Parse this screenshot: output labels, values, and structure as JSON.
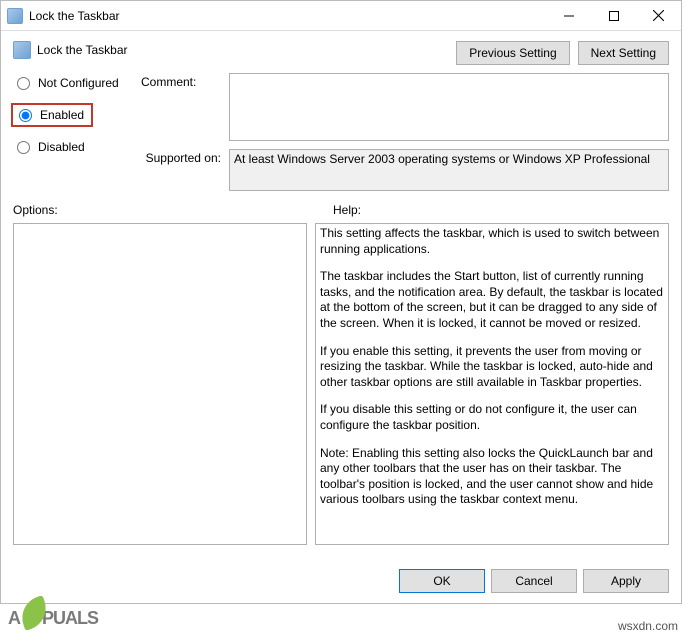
{
  "titlebar": {
    "title": "Lock the Taskbar"
  },
  "header": {
    "title": "Lock the Taskbar",
    "prev_label": "Previous Setting",
    "next_label": "Next Setting"
  },
  "radios": {
    "not_configured": "Not Configured",
    "enabled": "Enabled",
    "disabled": "Disabled",
    "selected": "Enabled"
  },
  "labels": {
    "comment": "Comment:",
    "supported": "Supported on:",
    "options": "Options:",
    "help": "Help:"
  },
  "comment_value": "",
  "supported_value": "At least Windows Server 2003 operating systems or Windows XP Professional",
  "options_value": "",
  "help_paragraphs": [
    "This setting affects the taskbar, which is used to switch between running applications.",
    "The taskbar includes the Start button, list of currently running tasks, and the notification area. By default, the taskbar is located at the bottom of the screen, but it can be dragged to any side of the screen. When it is locked, it cannot be moved or resized.",
    "If you enable this setting, it prevents the user from moving or resizing the taskbar. While the taskbar is locked, auto-hide and other taskbar options are still available in Taskbar properties.",
    "If you disable this setting or do not configure it, the user can configure the taskbar position.",
    "Note: Enabling this setting also locks the QuickLaunch bar and any other toolbars that the user has on their taskbar. The toolbar's position is locked, and the user cannot show and hide various toolbars using the taskbar context menu."
  ],
  "footer": {
    "ok": "OK",
    "cancel": "Cancel",
    "apply": "Apply"
  },
  "watermark": {
    "brand_left": "A",
    "brand_right": "PUALS",
    "site": "wsxdn.com"
  }
}
